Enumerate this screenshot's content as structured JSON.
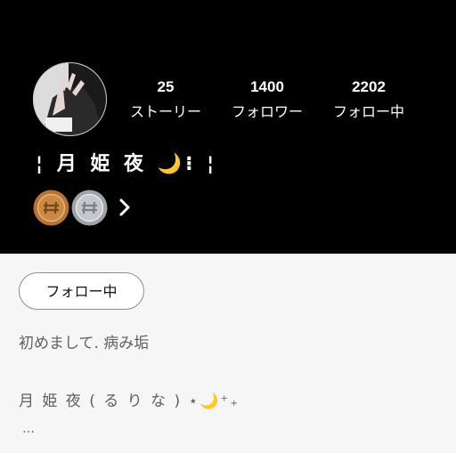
{
  "profile": {
    "display_name": "¦ 月 姫 夜 🌙⁝ ¦",
    "avatar_icon": "profile-photo",
    "stats": {
      "stories": {
        "value": "25",
        "label": "ストーリー"
      },
      "followers": {
        "value": "1400",
        "label": "フォロワー"
      },
      "following": {
        "value": "2202",
        "label": "フォロー中"
      }
    },
    "badges": [
      {
        "icon": "bronze-coin-badge",
        "color": "#b8742e"
      },
      {
        "icon": "silver-coin-badge",
        "color": "#b9bcc0"
      }
    ],
    "badges_more_icon": "chevron-right-icon"
  },
  "actions": {
    "follow_label": "フォロー中"
  },
  "bio": {
    "line1": "初めまして. 病み垢",
    "line2": "月 姫 夜 ( る り な ) ⋆🌙⁺₊",
    "more": "…"
  },
  "colors": {
    "header_bg": "#000000",
    "body_bg": "#f6f6f6",
    "text_white": "#ffffff",
    "bio_text": "#5f5f5f"
  }
}
